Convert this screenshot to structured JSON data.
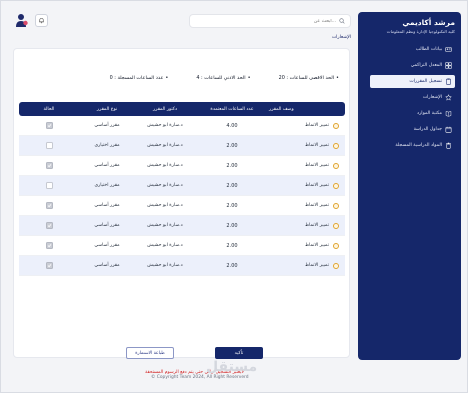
{
  "sidebar": {
    "title": "مرشد أكاديمي",
    "subtitle": "كلية التكنولوجيا الإدارة ونظم المعلومات",
    "items": [
      {
        "label": "بيانات الطالب",
        "icon": "user-card-icon",
        "active": false
      },
      {
        "label": "المعدل التراكمي",
        "icon": "grid-icon",
        "active": false
      },
      {
        "label": "تسجيل المقررات",
        "icon": "clipboard-icon",
        "active": true
      },
      {
        "label": "الإشعارات",
        "icon": "star-icon",
        "active": false
      },
      {
        "label": "مكتبة الموارد",
        "icon": "book-icon",
        "active": false
      },
      {
        "label": "جداول الدراسة",
        "icon": "calendar-icon",
        "active": false
      },
      {
        "label": "المواد الدراسية المسجلة",
        "icon": "trash-icon",
        "active": false
      }
    ]
  },
  "search": {
    "placeholder": "ابحث عن..."
  },
  "breadcrumb": "الإشعارات",
  "stats": {
    "max": "الحد الاقصى للساعات : 20",
    "min": "الحد الادني للساعات : 4",
    "registered": "عدد الساعات المسجلة : 0"
  },
  "table": {
    "headers": [
      "وصف المقرر",
      "عدد الساعات المعتمدة",
      "دكتور المقرر",
      "نوع المقرر",
      "الحالة"
    ],
    "rows": [
      {
        "name": "تمييز الانماط",
        "hours": "4.00",
        "doctor": "د.سارة ابو حشيش",
        "type": "مقرر أساسي",
        "checked": true
      },
      {
        "name": "تمييز الانماط",
        "hours": "2.00",
        "doctor": "د.سارة ابو حشيش",
        "type": "مقرر اختياري",
        "checked": false
      },
      {
        "name": "تمييز الانماط",
        "hours": "2.00",
        "doctor": "د.سارة ابو حشيش",
        "type": "مقرر أساسي",
        "checked": true
      },
      {
        "name": "تمييز الانماط",
        "hours": "2.00",
        "doctor": "د.سارة ابو حشيش",
        "type": "مقرر اختياري",
        "checked": false
      },
      {
        "name": "تمييز الانماط",
        "hours": "2.00",
        "doctor": "د.سارة ابو حشيش",
        "type": "مقرر أساسي",
        "checked": true
      },
      {
        "name": "تمييز الانماط",
        "hours": "2.00",
        "doctor": "د.سارة ابو حشيش",
        "type": "مقرر أساسي",
        "checked": true
      },
      {
        "name": "تمييز الانماط",
        "hours": "2.00",
        "doctor": "د.سارة ابو حشيش",
        "type": "مقرر أساسي",
        "checked": true
      },
      {
        "name": "تمييز الانماط",
        "hours": "2.00",
        "doctor": "د.سارة ابو حشيش",
        "type": "مقرر أساسي",
        "checked": true
      }
    ]
  },
  "actions": {
    "confirm": "تأكيد",
    "print": "طباعة الاستمارة",
    "warning": "لايعتبر التسجيل نهائي حتى يتم دفع الرسوم المستحقة"
  },
  "footer": "© Copyright Team 2024, All Right Reserverd",
  "watermark": "مستقل",
  "colors": {
    "primary": "#15276a",
    "alt_row": "#ecf0fb",
    "warning": "#d11e1e"
  }
}
